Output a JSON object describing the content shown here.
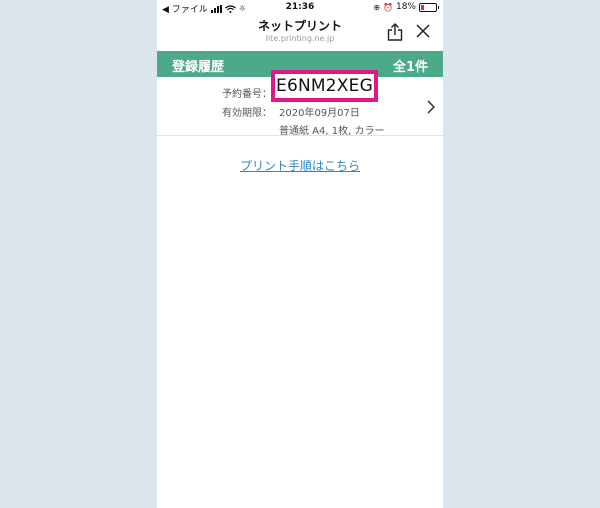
{
  "status_bar": {
    "carrier": "◀ ファイル",
    "time": "21:36",
    "battery": "18%",
    "battery_level": 0.18
  },
  "nav": {
    "title": "ネットプリント",
    "subtitle": "lite.printing.ne.jp",
    "icons": [
      "share-icon",
      "close-icon"
    ]
  },
  "history": {
    "title": "登録履歴",
    "count": "全1件",
    "entry": {
      "reservation_label": "予約番号：",
      "reservation_code": "E6NM2XEG",
      "expiry_label": "有効期限：",
      "expiry_value": "2020年09月07日",
      "details": "普通紙 A4, 1枚, カラー"
    }
  },
  "print_guide_link": "プリント手順はこちら",
  "colors": {
    "header_green": "#4caa88",
    "highlight_magenta": "#e0168c",
    "link_blue": "#2e86c8"
  }
}
